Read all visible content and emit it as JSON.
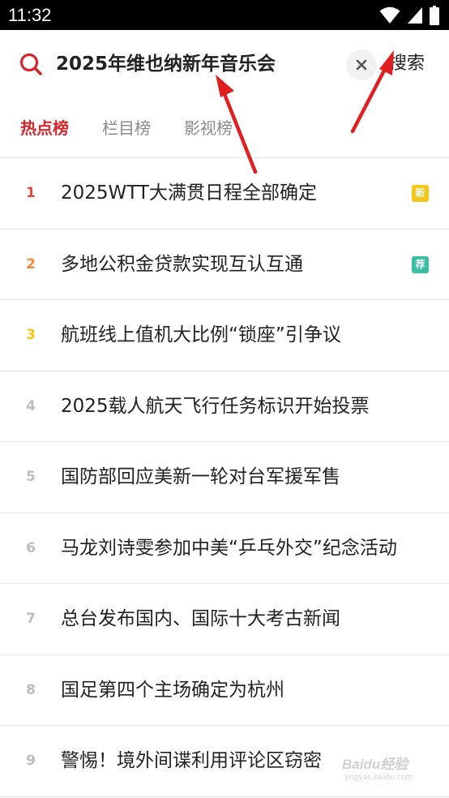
{
  "status_bar": {
    "time": "11:32",
    "icons": [
      "wifi-icon",
      "signal-icon",
      "battery-icon"
    ]
  },
  "search": {
    "query": "2025年维也纳新年音乐会",
    "clear_icon": "close-icon",
    "button_label": "搜索",
    "accent": "#d6262b"
  },
  "tabs": [
    {
      "label": "热点榜",
      "active": true
    },
    {
      "label": "栏目榜",
      "active": false
    },
    {
      "label": "影视榜",
      "active": false
    }
  ],
  "hot_list": [
    {
      "rank": "1",
      "title": "2025WTT大满贯日程全部确定",
      "badge": "新",
      "badge_color": "#f5c518",
      "rank_color": "#e5483f"
    },
    {
      "rank": "2",
      "title": "多地公积金贷款实现互认互通",
      "badge": "荐",
      "badge_color": "#3bbfa3",
      "rank_color": "#f08a3c"
    },
    {
      "rank": "3",
      "title": "航班线上值机大比例“锁座”引争议",
      "badge": "",
      "badge_color": "",
      "rank_color": "#f5c518"
    },
    {
      "rank": "4",
      "title": "2025载人航天飞行任务标识开始投票",
      "badge": "",
      "badge_color": "",
      "rank_color": "#bdbdbd"
    },
    {
      "rank": "5",
      "title": "国防部回应美新一轮对台军援军售",
      "badge": "",
      "badge_color": "",
      "rank_color": "#bdbdbd"
    },
    {
      "rank": "6",
      "title": "马龙刘诗雯参加中美“乒乓外交”纪念活动",
      "badge": "",
      "badge_color": "",
      "rank_color": "#bdbdbd"
    },
    {
      "rank": "7",
      "title": "总台发布国内、国际十大考古新闻",
      "badge": "",
      "badge_color": "",
      "rank_color": "#bdbdbd"
    },
    {
      "rank": "8",
      "title": "国足第四个主场确定为杭州",
      "badge": "",
      "badge_color": "",
      "rank_color": "#bdbdbd"
    },
    {
      "rank": "9",
      "title": "警惕！境外间谍利用评论区窃密",
      "badge": "",
      "badge_color": "",
      "rank_color": "#bdbdbd"
    }
  ],
  "annotation_color": "#e02020",
  "watermark": {
    "logo": "Baidu经验",
    "sub": "jingyan.baidu.com"
  }
}
